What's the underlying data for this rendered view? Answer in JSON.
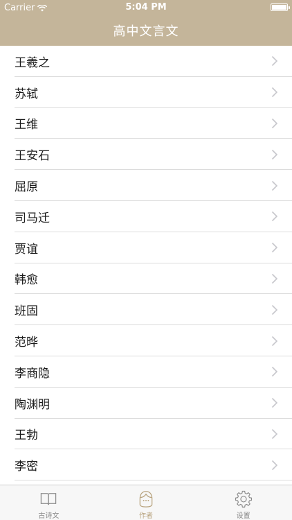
{
  "status_bar": {
    "carrier": "Carrier",
    "time": "5:04 PM"
  },
  "nav": {
    "title": "高中文言文"
  },
  "authors": [
    "王羲之",
    "苏轼",
    "王维",
    "王安石",
    "屈原",
    "司马迁",
    "贾谊",
    "韩愈",
    "班固",
    "范晔",
    "李商隐",
    "陶渊明",
    "王勃",
    "李密"
  ],
  "tabs": [
    {
      "label": "古诗文",
      "icon": "book-icon",
      "active": false
    },
    {
      "label": "作者",
      "icon": "person-icon",
      "active": true
    },
    {
      "label": "设置",
      "icon": "gear-icon",
      "active": false
    }
  ],
  "colors": {
    "accent": "#c4b59a",
    "tab_active": "#b8a37e",
    "tab_inactive": "#8a8a8a"
  }
}
